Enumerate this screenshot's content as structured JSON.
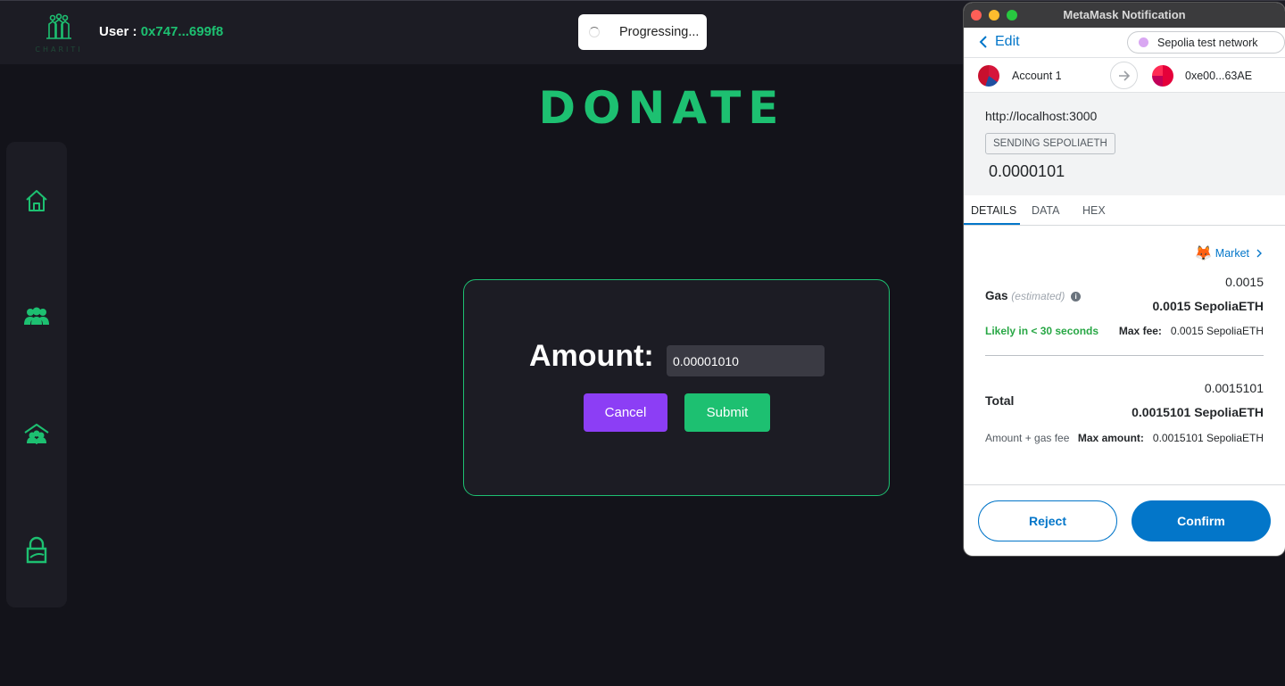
{
  "app": {
    "logo_text": "CHARITI",
    "user_label": "User : ",
    "user_address": "0x747...699f8",
    "toast_text": "Progressing...",
    "page_title": "DONATE",
    "colors": {
      "accent": "#1dc071",
      "cancel": "#8c3ef5",
      "background": "#13131a",
      "panel": "#1c1c24"
    }
  },
  "sidebar": {
    "items": [
      {
        "name": "home-icon"
      },
      {
        "name": "users-icon"
      },
      {
        "name": "charity-house-icon"
      },
      {
        "name": "profile-icon"
      }
    ]
  },
  "donate_form": {
    "amount_label": "Amount:",
    "amount_value": "0.00001010",
    "cancel_label": "Cancel",
    "submit_label": "Submit"
  },
  "metamask": {
    "window_title": "MetaMask Notification",
    "edit_label": "Edit",
    "network": "Sepolia test network",
    "from_account": "Account 1",
    "to_account": "0xe00...63AE",
    "origin": "http://localhost:3000",
    "action_badge": "SENDING SEPOLIAETH",
    "amount": "0.0000101",
    "tabs": [
      "DETAILS",
      "DATA",
      "HEX"
    ],
    "market_label": "Market",
    "gas_label": "Gas",
    "gas_estimated": "(estimated)",
    "gas_fiat": "0.0015",
    "gas_amount": "0.0015 SepoliaETH",
    "likely_text": "Likely in < 30 seconds",
    "max_fee_label": "Max fee:",
    "max_fee_value": "0.0015 SepoliaETH",
    "total_label": "Total",
    "total_fiat": "0.0015101",
    "total_amount": "0.0015101 SepoliaETH",
    "amount_gas_fee": "Amount + gas fee",
    "max_amount_label": "Max amount:",
    "max_amount_value": "0.0015101 SepoliaETH",
    "reject_label": "Reject",
    "confirm_label": "Confirm",
    "colors": {
      "primary": "#0376c9",
      "success": "#28a745"
    }
  }
}
